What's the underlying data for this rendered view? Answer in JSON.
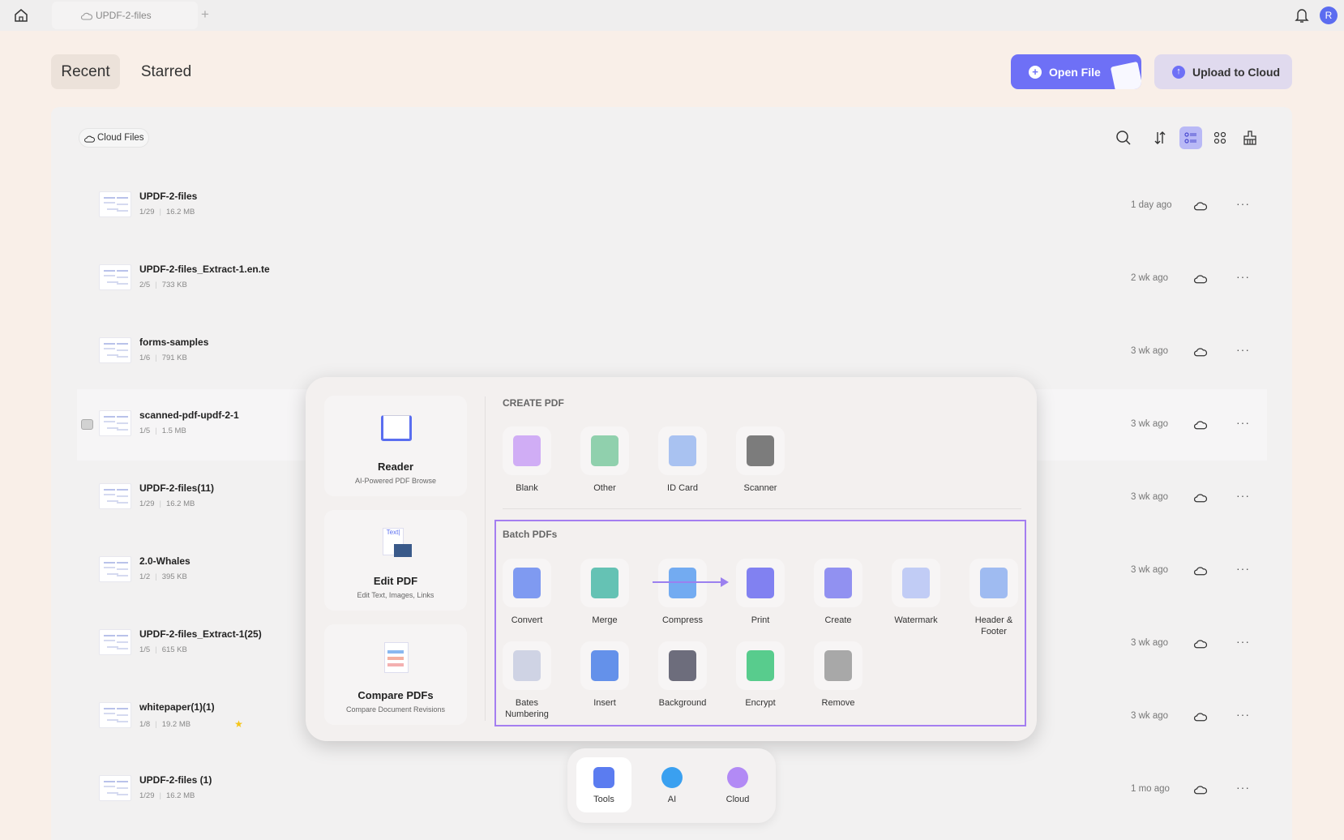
{
  "titlebar": {
    "tab_label": "UPDF-2-files",
    "new_tab": "+",
    "avatar_initial": "R"
  },
  "header": {
    "tabs": [
      {
        "label": "Recent",
        "active": true
      },
      {
        "label": "Starred",
        "active": false
      }
    ],
    "open_file": "Open File",
    "upload": "Upload to Cloud"
  },
  "toolbar": {
    "filter_chip": "Cloud Files",
    "icons": [
      "search-icon",
      "sort-icon",
      "list-view-icon",
      "grid-view-icon",
      "clean-icon"
    ]
  },
  "files": [
    {
      "name": "UPDF-2-files",
      "pages": "1/29",
      "size": "16.2 MB",
      "date": "1 day ago"
    },
    {
      "name": "UPDF-2-files_Extract-1.en.te",
      "pages": "2/5",
      "size": "733 KB",
      "date": "2 wk ago"
    },
    {
      "name": "forms-samples",
      "pages": "1/6",
      "size": "791 KB",
      "date": "3 wk ago"
    },
    {
      "name": "scanned-pdf-updf-2-1",
      "pages": "1/5",
      "size": "1.5 MB",
      "date": "3 wk ago",
      "hover": true
    },
    {
      "name": "UPDF-2-files(11)",
      "pages": "1/29",
      "size": "16.2 MB",
      "date": "3 wk ago"
    },
    {
      "name": "2.0-Whales",
      "pages": "1/2",
      "size": "395 KB",
      "date": "3 wk ago"
    },
    {
      "name": "UPDF-2-files_Extract-1(25)",
      "pages": "1/5",
      "size": "615 KB",
      "date": "3 wk ago"
    },
    {
      "name": "whitepaper(1)(1)",
      "pages": "1/8",
      "size": "19.2 MB",
      "date": "3 wk ago",
      "starred": true
    },
    {
      "name": "UPDF-2-files (1)",
      "pages": "1/29",
      "size": "16.2 MB",
      "date": "1 mo ago"
    }
  ],
  "popup": {
    "cards": [
      {
        "title": "Reader",
        "subtitle": "AI-Powered PDF Browse",
        "color": "#5a6ef0"
      },
      {
        "title": "Edit PDF",
        "subtitle": "Edit Text, Images, Links",
        "color": "#7a8cf2"
      },
      {
        "title": "Compare PDFs",
        "subtitle": "Compare Document Revisions",
        "color": "#f08a8a"
      }
    ],
    "create_title": "CREATE PDF",
    "create_items": [
      {
        "label": "Blank",
        "color": "#c9a0f5"
      },
      {
        "label": "Other",
        "color": "#7ec9a0"
      },
      {
        "label": "ID Card",
        "color": "#9bb8f0"
      },
      {
        "label": "Scanner",
        "color": "#666666"
      }
    ],
    "batch_title": "Batch PDFs",
    "batch_items": [
      {
        "label": "Convert",
        "color": "#6a8af0"
      },
      {
        "label": "Merge",
        "color": "#4bb8a8"
      },
      {
        "label": "Compress",
        "color": "#5c9ef0"
      },
      {
        "label": "Print",
        "color": "#6c6cf0"
      },
      {
        "label": "Create",
        "color": "#7f7ff0"
      },
      {
        "label": "Watermark",
        "color": "#b7c4f5"
      },
      {
        "label": "Header & Footer",
        "color": "#8fb0f0"
      },
      {
        "label": "Bates Numbering",
        "color": "#c8cde0"
      },
      {
        "label": "Insert",
        "color": "#4a7fe8"
      },
      {
        "label": "Background",
        "color": "#555566"
      },
      {
        "label": "Encrypt",
        "color": "#3cc47a"
      },
      {
        "label": "Remove",
        "color": "#9a9a9a"
      }
    ]
  },
  "dock": [
    {
      "label": "Tools",
      "active": true,
      "color": "#5b7cf0"
    },
    {
      "label": "AI",
      "active": false,
      "color": "#3aa0f0"
    },
    {
      "label": "Cloud",
      "active": false,
      "color": "#b28af5"
    }
  ],
  "colors": {
    "accent": "#6e70f6",
    "batch_border": "#a47ef0",
    "star": "#f5c518"
  }
}
